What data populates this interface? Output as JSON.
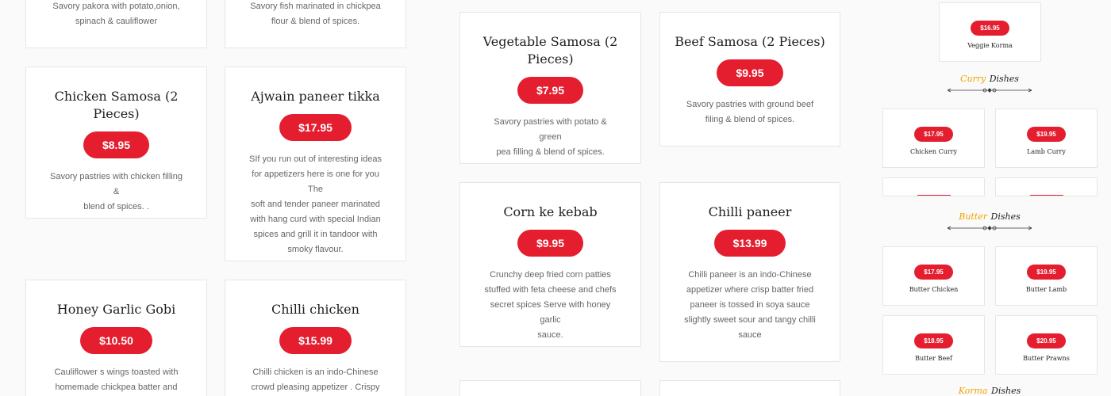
{
  "colors": {
    "accent": "#e41e2f",
    "gold": "#f0a500",
    "border": "#e6e6e6"
  },
  "left_cards": [
    {
      "desc": [
        "Savory pakora with potato,onion,",
        "spinach & cauliflower"
      ]
    },
    {
      "desc": [
        "Savory fish marinated in chickpea",
        "flour & blend of spices."
      ]
    },
    {
      "title": [
        "Chicken Samosa (2",
        "Pieces)"
      ],
      "price": "$8.95",
      "desc": [
        "Savory pastries with chicken filling &",
        "blend of spices. ."
      ]
    },
    {
      "title": [
        "Ajwain paneer tikka"
      ],
      "price": "$17.95",
      "desc": [
        "SIf you run out of interesting ideas",
        "for appetizers here is one for you The",
        "soft and tender paneer marinated",
        "with hang curd with special Indian",
        "spices and grill it in tandoor with",
        "smoky flavour."
      ]
    },
    {
      "title": [
        "Honey Garlic Gobi"
      ],
      "price": "$10.50",
      "desc": [
        "Cauliflower s wings toasted with",
        "homemade chickpea batter and"
      ]
    },
    {
      "title": [
        "Chilli chicken"
      ],
      "price": "$15.99",
      "desc": [
        "Chilli chicken is an indo-Chinese",
        "crowd pleasing appetizer . Crispy"
      ]
    }
  ],
  "mid_cards": [
    {
      "title": [
        "Vegetable Samosa (2",
        "Pieces)"
      ],
      "price": "$7.95",
      "desc": [
        "Savory pastries with potato & green",
        "pea filling & blend of spices."
      ]
    },
    {
      "title": [
        "Beef Samosa (2 Pieces)"
      ],
      "price": "$9.95",
      "desc": [
        "Savory pastries with ground beef",
        "filing & blend of spices."
      ]
    },
    {
      "title": [
        "Corn ke kebab"
      ],
      "price": "$9.95",
      "desc": [
        "Crunchy deep fried corn patties",
        "stuffed with feta cheese and chefs",
        "secret spices Serve with honey garlic",
        "sauce."
      ]
    },
    {
      "title": [
        "Chilli paneer"
      ],
      "price": "$13.99",
      "desc": [
        "Chilli paneer is an indo-Chinese",
        "appetizer where crisp batter fried",
        "paneer is tossed in soya sauce",
        "slightly sweet sour and tangy chilli",
        "sauce"
      ]
    }
  ],
  "right": {
    "top_item": {
      "price": "$16.95",
      "name": "Veggie Korma"
    },
    "sections": [
      {
        "word_a": "Curry",
        "word_b": "Dishes",
        "items": [
          {
            "price": "$17.95",
            "name": "Chicken Curry"
          },
          {
            "price": "$19.95",
            "name": "Lamb Curry"
          }
        ]
      },
      {
        "word_a": "Butter",
        "word_b": "Dishes",
        "items": [
          {
            "price": "$17.95",
            "name": "Butter Chicken"
          },
          {
            "price": "$19.95",
            "name": "Butter Lamb"
          },
          {
            "price": "$18.95",
            "name": "Butter Beef"
          },
          {
            "price": "$20.95",
            "name": "Butter Prawns"
          }
        ]
      },
      {
        "word_a": "Korma",
        "word_b": "Dishes"
      }
    ]
  }
}
